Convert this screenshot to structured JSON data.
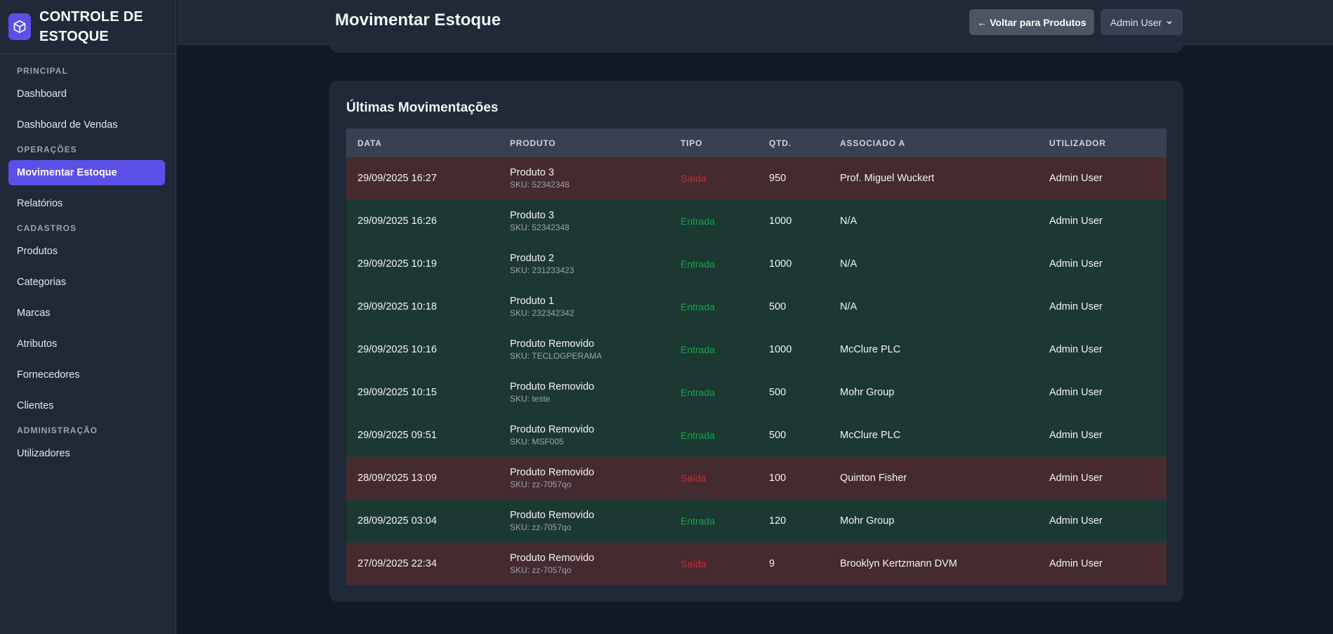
{
  "sidebar": {
    "brand_line1": "CONTROLE DE",
    "brand_line2": "ESTOQUE",
    "sections": {
      "principal": "PRINCIPAL",
      "operacoes": "OPERAÇÕES",
      "cadastros": "CADASTROS",
      "administracao": "ADMINISTRAÇÃO"
    },
    "items": {
      "dashboard": "Dashboard",
      "dashboard_vendas": "Dashboard de Vendas",
      "movimentar_estoque": "Movimentar Estoque",
      "relatorios": "Relatórios",
      "produtos": "Produtos",
      "categorias": "Categorias",
      "marcas": "Marcas",
      "atributos": "Atributos",
      "fornecedores": "Fornecedores",
      "clientes": "Clientes",
      "utilizadores": "Utilizadores"
    },
    "active_item": "movimentar_estoque"
  },
  "header": {
    "title": "Movimentar Estoque",
    "back_label": "← Voltar para Produtos",
    "user_label": "Admin User"
  },
  "movements": {
    "title": "Últimas Movimentações",
    "columns": [
      "DATA",
      "PRODUTO",
      "TIPO",
      "QTD.",
      "ASSOCIADO A",
      "UTILIZADOR"
    ],
    "rows": [
      {
        "date": "29/09/2025 16:27",
        "product": "Produto 3",
        "sku": "SKU: 52342348",
        "type": "Saída",
        "kind": "saida",
        "qty": "950",
        "assoc": "Prof. Miguel Wuckert",
        "user": "Admin User"
      },
      {
        "date": "29/09/2025 16:26",
        "product": "Produto 3",
        "sku": "SKU: 52342348",
        "type": "Entrada",
        "kind": "entrada",
        "qty": "1000",
        "assoc": "N/A",
        "user": "Admin User"
      },
      {
        "date": "29/09/2025 10:19",
        "product": "Produto 2",
        "sku": "SKU: 231233423",
        "type": "Entrada",
        "kind": "entrada",
        "qty": "1000",
        "assoc": "N/A",
        "user": "Admin User"
      },
      {
        "date": "29/09/2025 10:18",
        "product": "Produto 1",
        "sku": "SKU: 232342342",
        "type": "Entrada",
        "kind": "entrada",
        "qty": "500",
        "assoc": "N/A",
        "user": "Admin User"
      },
      {
        "date": "29/09/2025 10:16",
        "product": "Produto Removido",
        "sku": "SKU: TECLOGPERAMA",
        "type": "Entrada",
        "kind": "entrada",
        "qty": "1000",
        "assoc": "McClure PLC",
        "user": "Admin User"
      },
      {
        "date": "29/09/2025 10:15",
        "product": "Produto Removido",
        "sku": "SKU: teste",
        "type": "Entrada",
        "kind": "entrada",
        "qty": "500",
        "assoc": "Mohr Group",
        "user": "Admin User"
      },
      {
        "date": "29/09/2025 09:51",
        "product": "Produto Removido",
        "sku": "SKU: MSF005",
        "type": "Entrada",
        "kind": "entrada",
        "qty": "500",
        "assoc": "McClure PLC",
        "user": "Admin User"
      },
      {
        "date": "28/09/2025 13:09",
        "product": "Produto Removido",
        "sku": "SKU: zz-7057qo",
        "type": "Saída",
        "kind": "saida",
        "qty": "100",
        "assoc": "Quinton Fisher",
        "user": "Admin User"
      },
      {
        "date": "28/09/2025 03:04",
        "product": "Produto Removido",
        "sku": "SKU: zz-7057qo",
        "type": "Entrada",
        "kind": "entrada",
        "qty": "120",
        "assoc": "Mohr Group",
        "user": "Admin User"
      },
      {
        "date": "27/09/2025 22:34",
        "product": "Produto Removido",
        "sku": "SKU: zz-7057qo",
        "type": "Saída",
        "kind": "saida",
        "qty": "9",
        "assoc": "Brooklyn Kertzmann DVM",
        "user": "Admin User"
      }
    ]
  },
  "colors": {
    "accent": "#5b50e6",
    "saida_text": "#dc2626",
    "entrada_text": "#16a34a",
    "saida_row": "#452a30",
    "entrada_row": "#1c3832"
  },
  "icons": {
    "brand": "box-icon",
    "user_menu": "chevron-down-icon"
  }
}
